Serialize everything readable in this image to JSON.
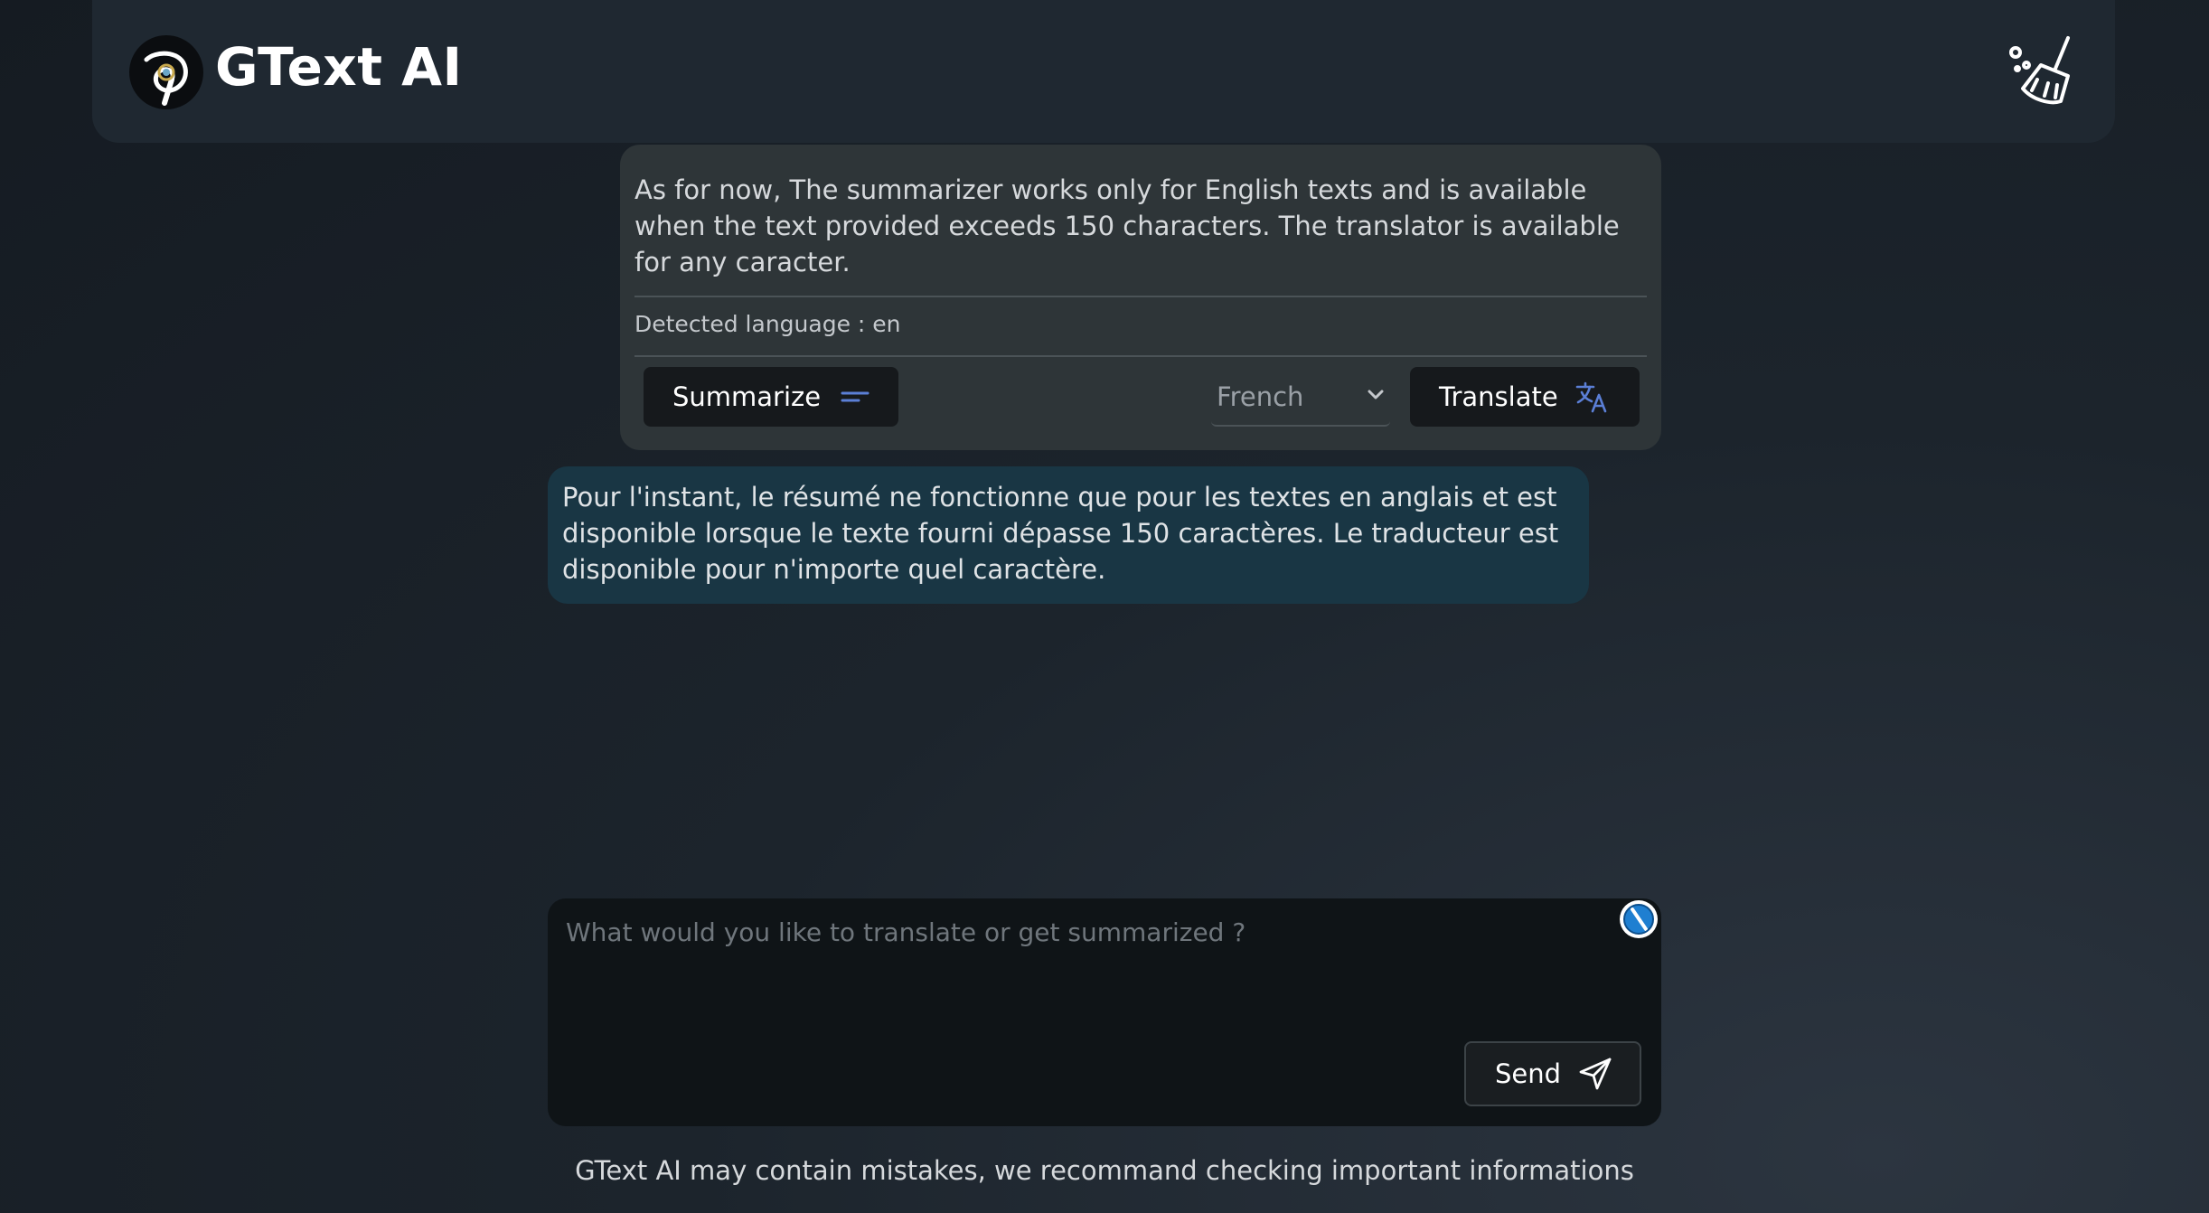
{
  "header": {
    "app_title": "GText AI",
    "logo_icon": "spiral-logo-icon",
    "clear_icon": "broom-icon"
  },
  "message_card": {
    "text": "As for now, The summarizer works only for English texts and is available when the text provided exceeds 150 characters. The translator is available for any caracter.",
    "detected_language": "Detected language : en",
    "summarize_label": "Summarize",
    "summarize_icon": "lines-icon",
    "language_selected": "French",
    "translate_label": "Translate",
    "translate_icon": "translate-icon"
  },
  "translation": {
    "text": "Pour l'instant, le résumé ne fonctionne que pour les textes en anglais et est disponible lorsque le texte fourni dépasse 150 caractères. Le traducteur est disponible pour n'importe quel caractère."
  },
  "input": {
    "placeholder": "What would you like to translate or get summarized ?",
    "value": "",
    "send_label": "Send",
    "send_icon": "paper-plane-icon",
    "assist_icon": "assistant-badge-icon"
  },
  "footer": {
    "disclaimer": "GText AI may contain mistakes, we recommand checking important informations"
  },
  "colors": {
    "background": "#1c242c",
    "header": "#1f2831",
    "card": "#2e3538",
    "translation_bubble": "#193644",
    "accent_icon": "#5b7fd6",
    "button": "#16191c"
  }
}
